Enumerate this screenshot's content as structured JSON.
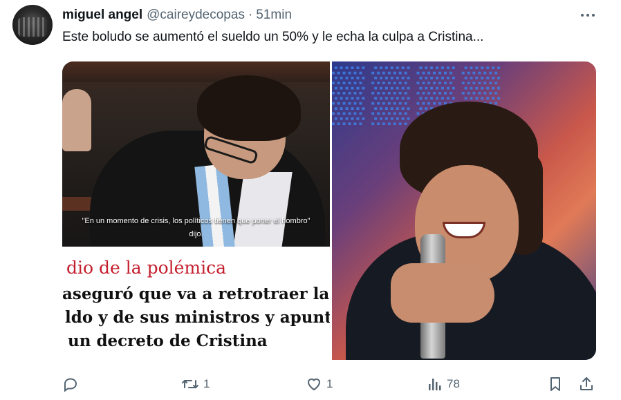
{
  "author": {
    "display_name": "miguel angel",
    "handle": "@caireydecopas",
    "separator": "·",
    "time": "51min"
  },
  "tweet": {
    "text": "Este boludo se aumentó el sueldo un 50% y le echa la culpa a Cristina..."
  },
  "media": {
    "left": {
      "caption_line1": "\"En un momento de crisis, los políticos tienen que poner el hombro\"",
      "caption_line2": "dijo.",
      "kicker": "dio de la polémica",
      "headline_line1": "aseguró que va a retrotraer la su",
      "headline_line2": "ldo y de sus ministros y apuntó",
      "headline_line3": "un decreto de Cristina"
    }
  },
  "actions": {
    "reply_count": "",
    "retweet_count": "1",
    "like_count": "1",
    "views_count": "78"
  },
  "colors": {
    "text_primary": "#0f1419",
    "text_secondary": "#536471",
    "kicker_red": "#c41e2d"
  },
  "icons": [
    "reply-icon",
    "retweet-icon",
    "like-icon",
    "views-icon",
    "bookmark-icon",
    "share-icon",
    "more-icon"
  ]
}
